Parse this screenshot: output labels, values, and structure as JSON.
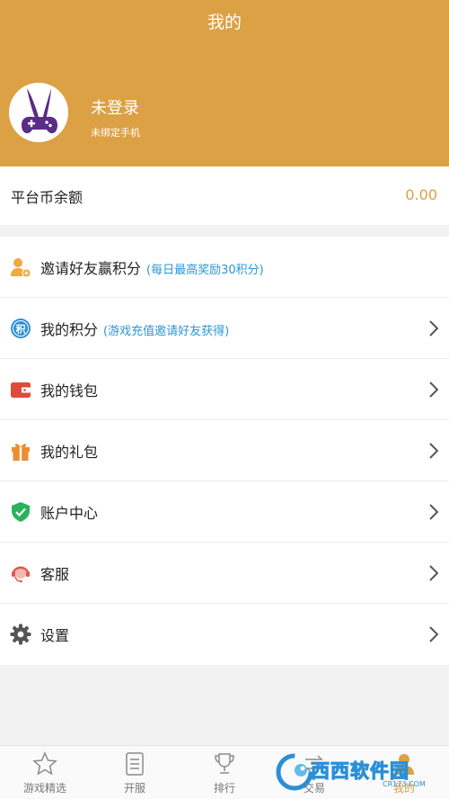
{
  "header": {
    "title": "我的"
  },
  "user": {
    "name": "未登录",
    "subtitle": "未绑定手机"
  },
  "balance": {
    "label": "平台币余额",
    "value": "0.00"
  },
  "menu": [
    {
      "icon": "invite-user-icon",
      "label": "邀请好友赢积分",
      "hint": "(每日最高奖励30积分)",
      "chevron": false
    },
    {
      "icon": "points-icon",
      "label": "我的积分",
      "hint": "(游戏充值邀请好友获得)",
      "chevron": true
    },
    {
      "icon": "wallet-icon",
      "label": "我的钱包",
      "hint": "",
      "chevron": true
    },
    {
      "icon": "gift-icon",
      "label": "我的礼包",
      "hint": "",
      "chevron": true
    },
    {
      "icon": "shield-check-icon",
      "label": "账户中心",
      "hint": "",
      "chevron": true
    },
    {
      "icon": "customer-service-icon",
      "label": "客服",
      "hint": "",
      "chevron": true
    },
    {
      "icon": "gear-icon",
      "label": "设置",
      "hint": "",
      "chevron": true
    }
  ],
  "tabbar": {
    "tabs": [
      {
        "icon": "star-icon",
        "label": "游戏精选"
      },
      {
        "icon": "document-icon",
        "label": "开服"
      },
      {
        "icon": "trophy-icon",
        "label": "排行"
      },
      {
        "icon": "trade-icon",
        "label": "交易"
      },
      {
        "icon": "user-icon",
        "label": "我的",
        "active": true
      }
    ]
  },
  "watermark": {
    "text": "西西软件园",
    "url": "CR173.COM"
  },
  "colors": {
    "accent": "#dca045",
    "hint_blue": "#2d96d3",
    "background": "#f2f2f2"
  }
}
